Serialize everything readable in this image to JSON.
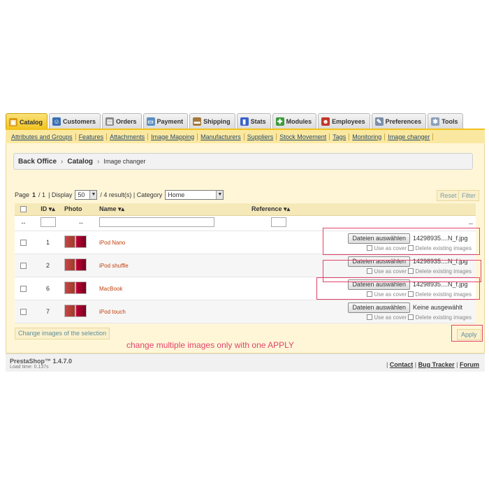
{
  "tabs": [
    {
      "label": "Catalog",
      "icon": "catalog-icon",
      "active": true
    },
    {
      "label": "Customers",
      "icon": "customers-icon"
    },
    {
      "label": "Orders",
      "icon": "orders-icon"
    },
    {
      "label": "Payment",
      "icon": "payment-icon"
    },
    {
      "label": "Shipping",
      "icon": "shipping-icon"
    },
    {
      "label": "Stats",
      "icon": "stats-icon"
    },
    {
      "label": "Modules",
      "icon": "modules-icon"
    },
    {
      "label": "Employees",
      "icon": "employees-icon"
    },
    {
      "label": "Preferences",
      "icon": "preferences-icon"
    },
    {
      "label": "Tools",
      "icon": "tools-icon"
    }
  ],
  "submenu": [
    "Attributes and Groups",
    "Features",
    "Attachments",
    "Image Mapping",
    "Manufacturers",
    "Suppliers",
    "Stock Movement",
    "Tags",
    "Monitoring",
    "Image changer"
  ],
  "breadcrumb": {
    "root": "Back Office",
    "section": "Catalog",
    "page": "Image changer"
  },
  "listbar": {
    "page_label": "Page",
    "page_current": "1",
    "page_total": "/ 1",
    "display_label": "| Display",
    "display_value": "50",
    "results": "/ 4 result(s) | Category",
    "category_value": "Home"
  },
  "buttons": {
    "reset": "Reset",
    "filter": "Filter",
    "change": "Change images of the selection",
    "apply": "Apply"
  },
  "columns": {
    "id": "ID",
    "photo": "Photo",
    "name": "Name",
    "reference": "Reference"
  },
  "filter_row": {
    "dash": "--"
  },
  "file_button": "Dateien auswählen",
  "option_cover": "Use as cover",
  "option_delete": "Delete existing images",
  "products": [
    {
      "id": "1",
      "name": "iPod Nano",
      "file": "14298935....N_f.jpg"
    },
    {
      "id": "2",
      "name": "iPod shuffle",
      "file": "14298935....N_f.jpg"
    },
    {
      "id": "6",
      "name": "MacBook",
      "file": "14298935....N_f.jpg"
    },
    {
      "id": "7",
      "name": "iPod touch",
      "file": "Keine ausgewählt"
    }
  ],
  "note": "change multiple images only with one APPLY",
  "footer": {
    "brand": "PrestaShop™ 1.4.7.0",
    "load": "Load time: 0.137s",
    "links": [
      "Contact",
      "Bug Tracker",
      "Forum"
    ]
  },
  "colors": {
    "accent": "#f0c21c",
    "highlight": "#e0446a",
    "link": "#264a6b"
  }
}
